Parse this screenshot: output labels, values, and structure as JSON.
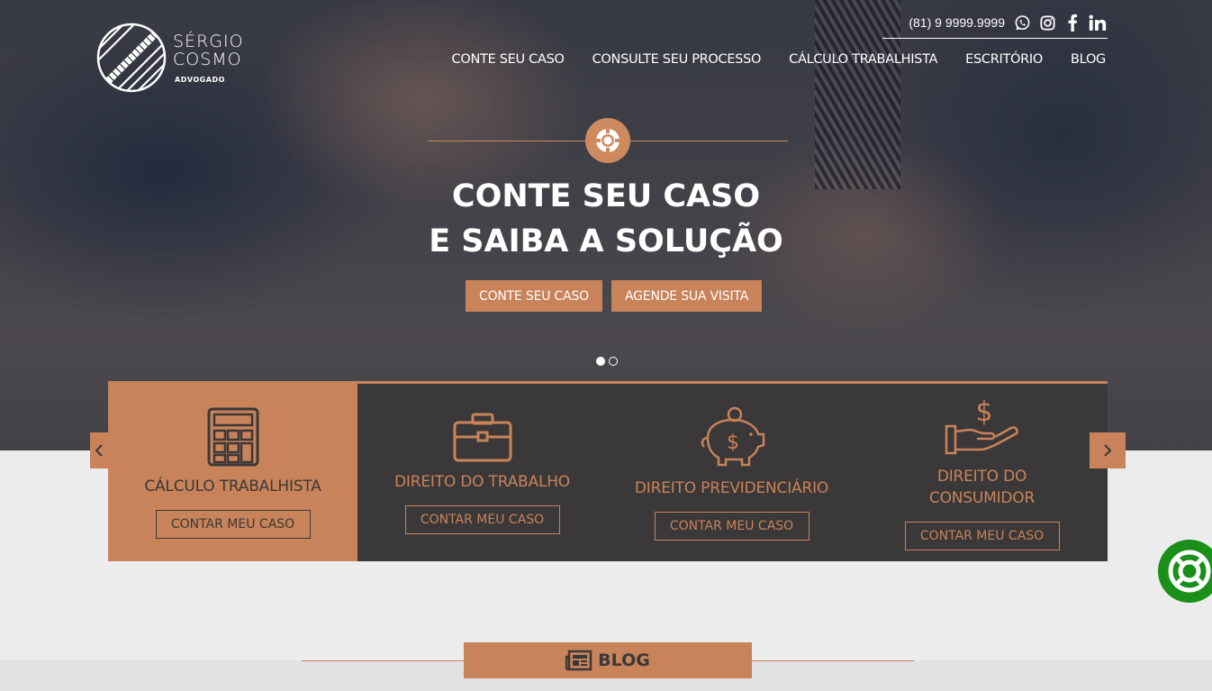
{
  "brand": {
    "name_line1": "SÉRGIO",
    "name_line2": "COSMO",
    "subtitle": "ADVOGADO"
  },
  "contact": {
    "phone": "(81) 9 9999.9999",
    "icons": [
      "whatsapp-icon",
      "instagram-icon",
      "facebook-icon",
      "linkedin-icon"
    ]
  },
  "nav": {
    "items": [
      "CONTE SEU CASO",
      "CONSULTE SEU PROCESSO",
      "CÁLCULO TRABALHISTA",
      "ESCRITÓRIO",
      "BLOG"
    ]
  },
  "hero": {
    "badge_icon": "lifebuoy-icon",
    "title_line1": "CONTE SEU CASO",
    "title_line2": "E SAIBA A SOLUÇÃO",
    "btn_primary": "CONTE SEU CASO",
    "btn_secondary": "AGENDE SUA VISITA",
    "slides": 2,
    "active_slide": 1
  },
  "services": {
    "cards": [
      {
        "icon": "calculator-icon",
        "title_line1": "CÁLCULO TRABALHISTA",
        "title_line2": "",
        "button": "CONTAR MEU CASO",
        "active": true
      },
      {
        "icon": "briefcase-icon",
        "title_line1": "DIREITO DO TRABALHO",
        "title_line2": "",
        "button": "CONTAR MEU CASO",
        "active": false
      },
      {
        "icon": "piggy-bank-icon",
        "title_line1": "DIREITO PREVIDENCIÁRIO",
        "title_line2": "",
        "button": "CONTAR MEU CASO",
        "active": false
      },
      {
        "icon": "hand-dollar-icon",
        "title_line1": "DIREITO DO",
        "title_line2": "CONSUMIDOR",
        "button": "CONTAR MEU CASO",
        "active": false
      }
    ]
  },
  "blog": {
    "label": "BLOG",
    "icon": "newspaper-icon"
  },
  "colors": {
    "accent": "#c9835a",
    "dark": "#3a3838",
    "float_green": "#1a8f1a"
  }
}
